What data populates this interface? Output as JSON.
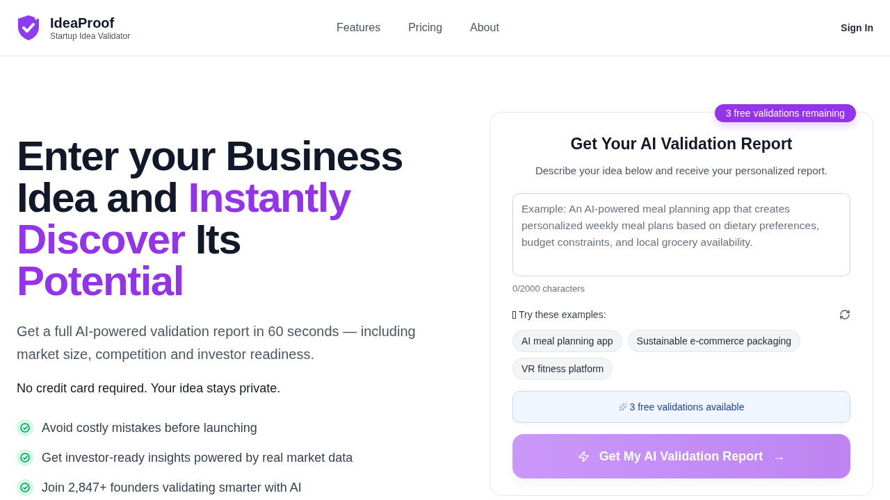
{
  "brand": {
    "name": "IdeaProof",
    "tagline": "Startup Idea Validator"
  },
  "nav": [
    {
      "label": "Features"
    },
    {
      "label": "Pricing"
    },
    {
      "label": "About"
    }
  ],
  "sign_in": "Sign In",
  "hero": {
    "headline_lines": [
      [
        {
          "text": "Enter your Business",
          "highlight": false
        }
      ],
      [
        {
          "text": "Idea and ",
          "highlight": false
        },
        {
          "text": "Instantly",
          "highlight": true
        }
      ],
      [
        {
          "text": "Discover",
          "highlight": true
        },
        {
          "text": " Its",
          "highlight": false
        }
      ],
      [
        {
          "text": "Potential",
          "highlight": true
        }
      ]
    ],
    "subtitle": "Get a full AI-powered validation report in 60 seconds — including market size, competition and investor readiness.",
    "note": "No credit card required. Your idea stays private.",
    "benefits": [
      "Avoid costly mistakes before launching",
      "Get investor-ready insights powered by real market data",
      "Join 2,847+ founders validating smarter with AI"
    ]
  },
  "card": {
    "badge": "3 free validations remaining",
    "title": "Get Your AI Validation Report",
    "subtitle": "Describe your idea below and receive your personalized report.",
    "idea_field": {
      "placeholder": "Example: An AI-powered meal planning app that creates personalized weekly meal plans based on dietary preferences, budget constraints, and local grocery availability."
    },
    "char_count": "0/2000 characters",
    "examples_label": "Try these examples:",
    "examples": [
      "AI meal planning app",
      "Sustainable e-commerce packaging",
      "VR fitness platform"
    ],
    "info": "3 free validations available",
    "submit": {
      "label": "Get My AI Validation Report",
      "arrow": "→",
      "disabled": true
    }
  }
}
